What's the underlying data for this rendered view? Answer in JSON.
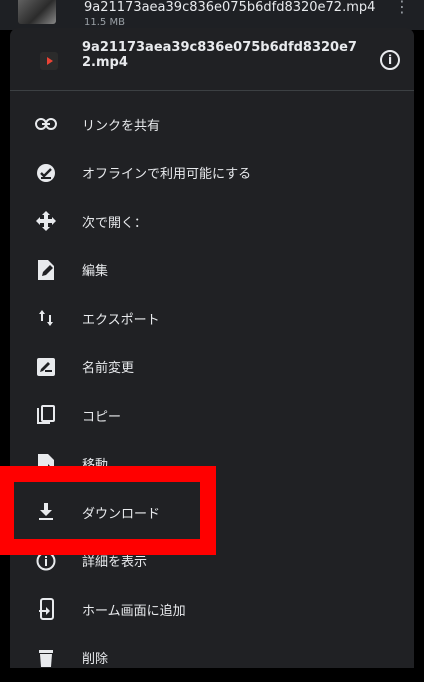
{
  "background_item": {
    "title": "9a21173aea39c836e075b6dfd8320e72.mp4",
    "subtitle": "11.5 MB"
  },
  "sheet": {
    "file_name": "9a21173aea39c836e075b6dfd8320e72.mp4",
    "info_icon": "info-icon"
  },
  "menu": [
    {
      "label": "リンクを共有",
      "icon": "link-icon"
    },
    {
      "label": "オフラインで利用可能にする",
      "icon": "offline-check-icon"
    },
    {
      "label": "次で開く：",
      "icon": "open-with-icon"
    },
    {
      "label": "編集",
      "icon": "edit-document-icon"
    },
    {
      "label": "エクスポート",
      "icon": "export-arrows-icon"
    },
    {
      "label": "名前変更",
      "icon": "rename-icon"
    },
    {
      "label": "コピー",
      "icon": "copy-icon"
    },
    {
      "label": "移動",
      "icon": "move-file-icon"
    },
    {
      "label": "ダウンロード",
      "icon": "download-icon"
    },
    {
      "label": "詳細を表示",
      "icon": "info-outline-icon"
    },
    {
      "label": "ホーム画面に追加",
      "icon": "add-to-home-icon"
    },
    {
      "label": "削除",
      "icon": "trash-icon"
    }
  ],
  "highlight_color": "#ff0000"
}
